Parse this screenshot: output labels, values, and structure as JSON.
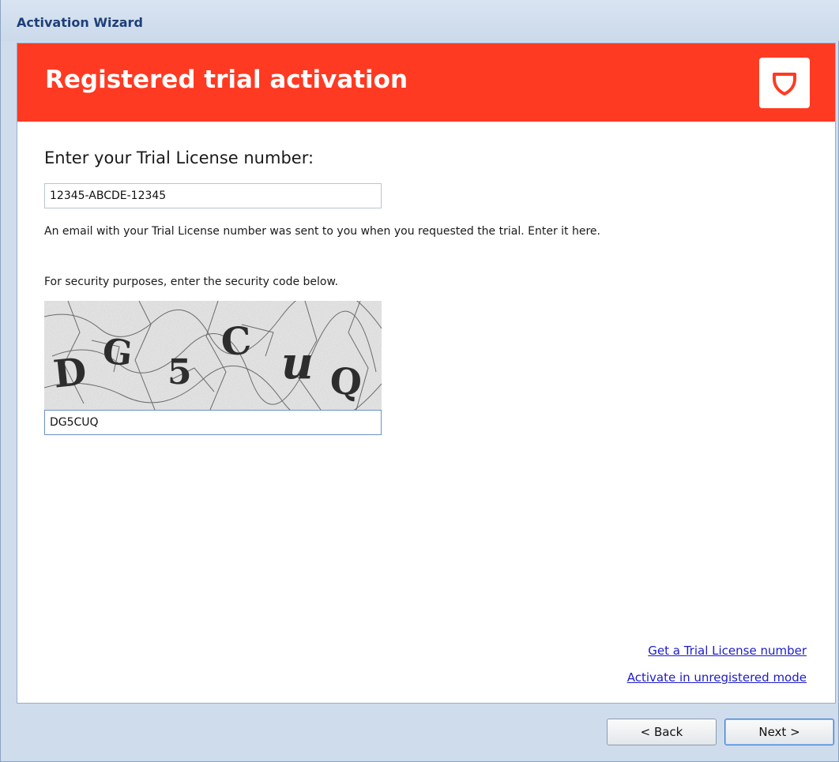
{
  "window": {
    "title": "Activation Wizard"
  },
  "banner": {
    "title": "Registered trial activation",
    "logo_icon": "shield-icon",
    "color": "#ff3a22"
  },
  "form": {
    "heading": "Enter your Trial License number:",
    "license_value": "12345-ABCDE-12345",
    "license_help": "An email with your Trial License number was sent to you when you requested the trial. Enter it here.",
    "security_prompt": "For security purposes, enter the security code below.",
    "captcha_chars": [
      "D",
      "G",
      "5",
      "C",
      "u",
      "Q"
    ],
    "captcha_value": "DG5CUQ"
  },
  "links": {
    "get_trial": "Get a Trial License number",
    "unregistered": "Activate in unregistered mode"
  },
  "buttons": {
    "back": "< Back",
    "next": "Next >"
  }
}
